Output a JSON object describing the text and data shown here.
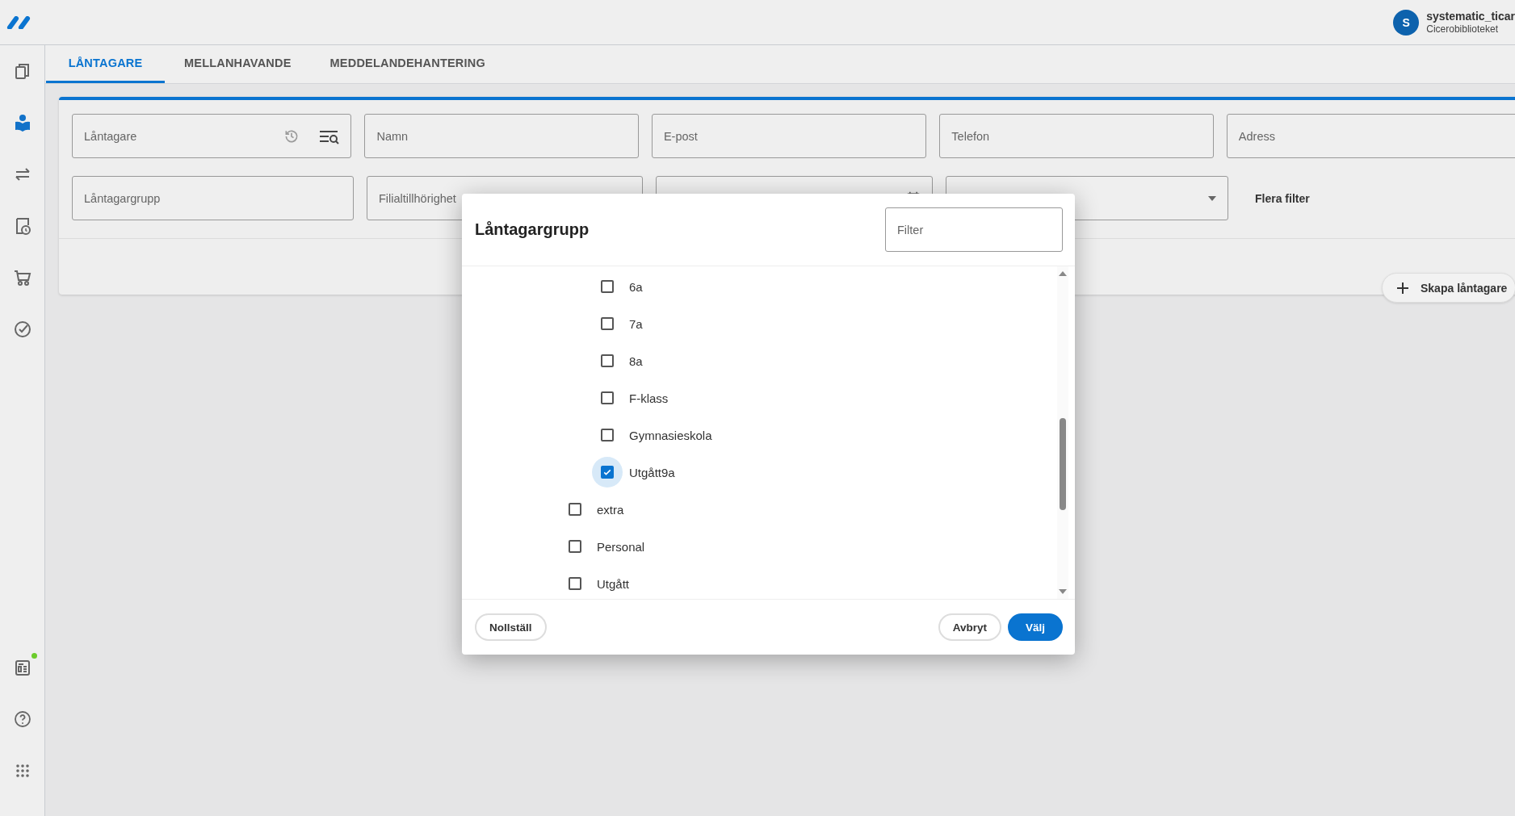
{
  "user": {
    "initial": "S",
    "name": "systematic_ticar",
    "library": "Cicerobiblioteket"
  },
  "sidebar": {
    "items": [
      {
        "selected": false,
        "notification": false
      },
      {
        "selected": true,
        "notification": false
      },
      {
        "selected": false,
        "notification": false
      },
      {
        "selected": false,
        "notification": false
      },
      {
        "selected": false,
        "notification": false
      },
      {
        "selected": false,
        "notification": false
      },
      {
        "selected": false,
        "notification": true
      },
      {
        "selected": false,
        "notification": false
      },
      {
        "selected": false,
        "notification": false
      }
    ]
  },
  "tabs": [
    {
      "label": "LÅNTAGARE",
      "selected": true
    },
    {
      "label": "MELLANHAVANDE",
      "selected": false
    },
    {
      "label": "MEDDELANDEHANTERING",
      "selected": false
    }
  ],
  "filters": {
    "rows": [
      [
        {
          "kind": "history-search",
          "placeholder": "Låntagare"
        },
        {
          "kind": "text",
          "placeholder": "Namn"
        },
        {
          "kind": "text",
          "placeholder": "E-post"
        },
        {
          "kind": "text",
          "placeholder": "Telefon"
        },
        {
          "kind": "wide",
          "placeholder": "Adress"
        }
      ],
      [
        {
          "kind": "text",
          "placeholder": "Låntagargrupp"
        },
        {
          "kind": "text",
          "placeholder": "Filialtillhörighet"
        },
        {
          "kind": "date"
        },
        {
          "kind": "select"
        }
      ]
    ],
    "more_filters": "Flera filter"
  },
  "create_button": {
    "label": "Skapa låntagare"
  },
  "dialog": {
    "title": "Låntagargrupp",
    "filter": {
      "placeholder": "Filter"
    },
    "items": [
      {
        "children": [
          {
            "label": "6a",
            "checked": false,
            "focused": false
          },
          {
            "label": "7a",
            "checked": false,
            "focused": false
          },
          {
            "label": "8a",
            "checked": false,
            "focused": false
          },
          {
            "label": "F-klass",
            "checked": false,
            "focused": false
          },
          {
            "label": "Gymnasieskola",
            "checked": false,
            "focused": false
          },
          {
            "label": "Utgått9a",
            "checked": true,
            "focused": true
          }
        ]
      },
      {
        "label": "extra",
        "checked": false,
        "focused": false
      },
      {
        "label": "Personal",
        "checked": false,
        "focused": false
      },
      {
        "label": "Utgått",
        "checked": false,
        "focused": false
      }
    ],
    "buttons": [
      {
        "label": "Nollställ",
        "kind": "outline"
      },
      {
        "label": "Avbryt",
        "kind": "outline"
      },
      {
        "label": "Välj",
        "kind": "primary"
      }
    ]
  }
}
